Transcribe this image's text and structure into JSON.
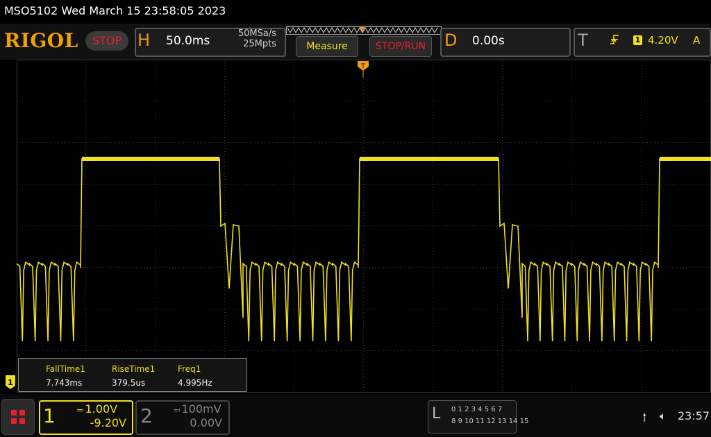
{
  "titlebar": {
    "title": "MSO5102  Wed March 15 23:58:05 2023"
  },
  "header": {
    "logo": "RIGOL",
    "run_state": "STOP",
    "horizontal": {
      "letter": "H",
      "timebase": "50.0ms",
      "sample_rate": "50MSa/s",
      "memory_depth": "25Mpts"
    },
    "measure_label": "Measure",
    "stoprun_label": "STOP/RUN",
    "delay": {
      "letter": "D",
      "value": "0.00s"
    },
    "trigger": {
      "letter": "T",
      "source": "1",
      "level": "4.20V",
      "mode": "A",
      "edge_icon": "rising-edge-icon"
    }
  },
  "measurements": [
    {
      "label": "FallTime1",
      "value": "7.743ms"
    },
    {
      "label": "RiseTime1",
      "value": "379.5us"
    },
    {
      "label": "Freq1",
      "value": "4.995Hz"
    }
  ],
  "channels": [
    {
      "num": "1",
      "scale": "1.00V",
      "offset": "-9.20V",
      "coupling_icon": "dc-coupling-icon",
      "color": "#f0e020",
      "active": true
    },
    {
      "num": "2",
      "scale": "100mV",
      "offset": "0.00V",
      "coupling_icon": "dc-coupling-icon",
      "color": "#888888",
      "active": false
    }
  ],
  "ch1_marker": "1",
  "logic": {
    "letter": "L",
    "row1": "0 1 2 3   4 5 6 7",
    "row2": "8  9 10 11  12 13 14 15"
  },
  "status": {
    "clock": "23:57",
    "usb_icon": "usb-icon",
    "mute_icon": "speaker-mute-icon"
  },
  "colors": {
    "trace": "#f0e020",
    "accent_orange": "#f29a1a",
    "stop_red": "#e0242a",
    "grid": "#3a3a3a"
  }
}
